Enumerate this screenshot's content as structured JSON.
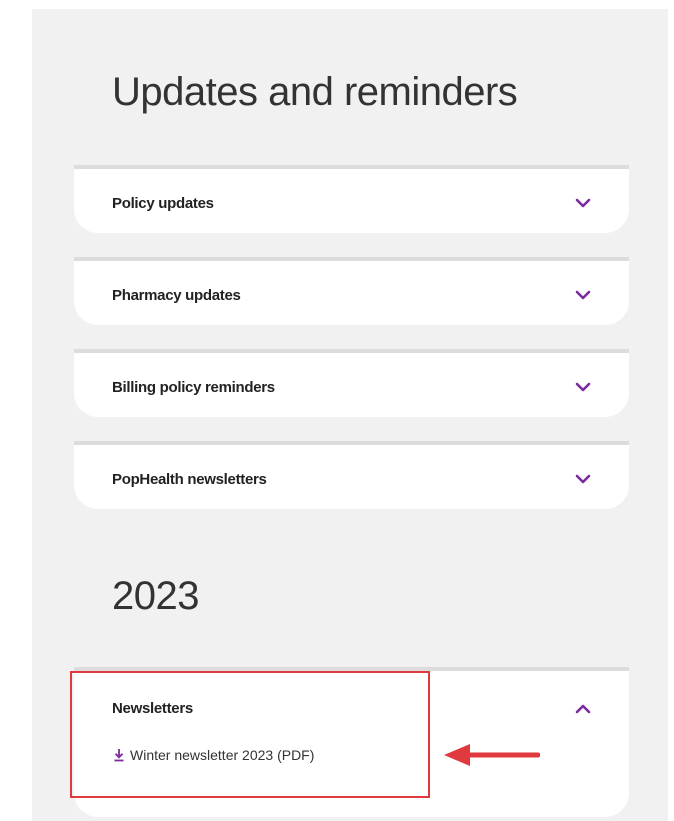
{
  "page": {
    "title": "Updates and reminders"
  },
  "accordions": [
    {
      "label": "Policy updates",
      "expanded": false
    },
    {
      "label": "Pharmacy updates",
      "expanded": false
    },
    {
      "label": "Billing policy reminders",
      "expanded": false
    },
    {
      "label": "PopHealth newsletters",
      "expanded": false
    }
  ],
  "year_section": {
    "title": "2023",
    "accordion": {
      "label": "Newsletters",
      "expanded": true,
      "link": {
        "text": "Winter newsletter 2023 (PDF)",
        "icon": "download-icon"
      }
    }
  },
  "annotation": {
    "highlight_color": "#e0393e",
    "arrow_icon": "left-arrow-icon"
  },
  "colors": {
    "accent": "#7b2a9f",
    "background": "#f1f1f1",
    "card": "#ffffff",
    "divider": "#dcdcdc"
  }
}
